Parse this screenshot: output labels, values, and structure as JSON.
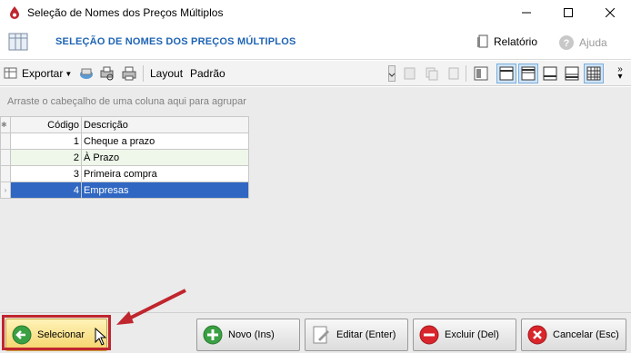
{
  "window": {
    "title": "Seleção de Nomes dos Preços Múltiplos",
    "controls": [
      "minimize",
      "maximize",
      "close"
    ]
  },
  "header": {
    "title": "SELEÇÃO DE NOMES DOS PREÇOS MÚLTIPLOS",
    "report_label": "Relatório",
    "help_label": "Ajuda"
  },
  "toolbar": {
    "export_label": "Exportar",
    "layout_label": "Layout",
    "layout_value": "Padrão"
  },
  "grid": {
    "group_hint": "Arraste o cabeçalho de uma coluna aqui para agrupar",
    "columns": [
      "Código",
      "Descrição"
    ],
    "rows": [
      {
        "code": "1",
        "desc": "Cheque a prazo"
      },
      {
        "code": "2",
        "desc": "À Prazo"
      },
      {
        "code": "3",
        "desc": "Primeira compra"
      },
      {
        "code": "4",
        "desc": "Empresas"
      }
    ],
    "selected_row": 4
  },
  "buttons": {
    "select": "Selecionar",
    "new": "Novo (Ins)",
    "edit": "Editar (Enter)",
    "delete": "Excluir (Del)",
    "cancel": "Cancelar (Esc)"
  },
  "colors": {
    "header_title": "#1e64b4",
    "selected_row": "#2f67c2",
    "highlight": "#c0262e",
    "primary_button": "#f5d46a"
  }
}
